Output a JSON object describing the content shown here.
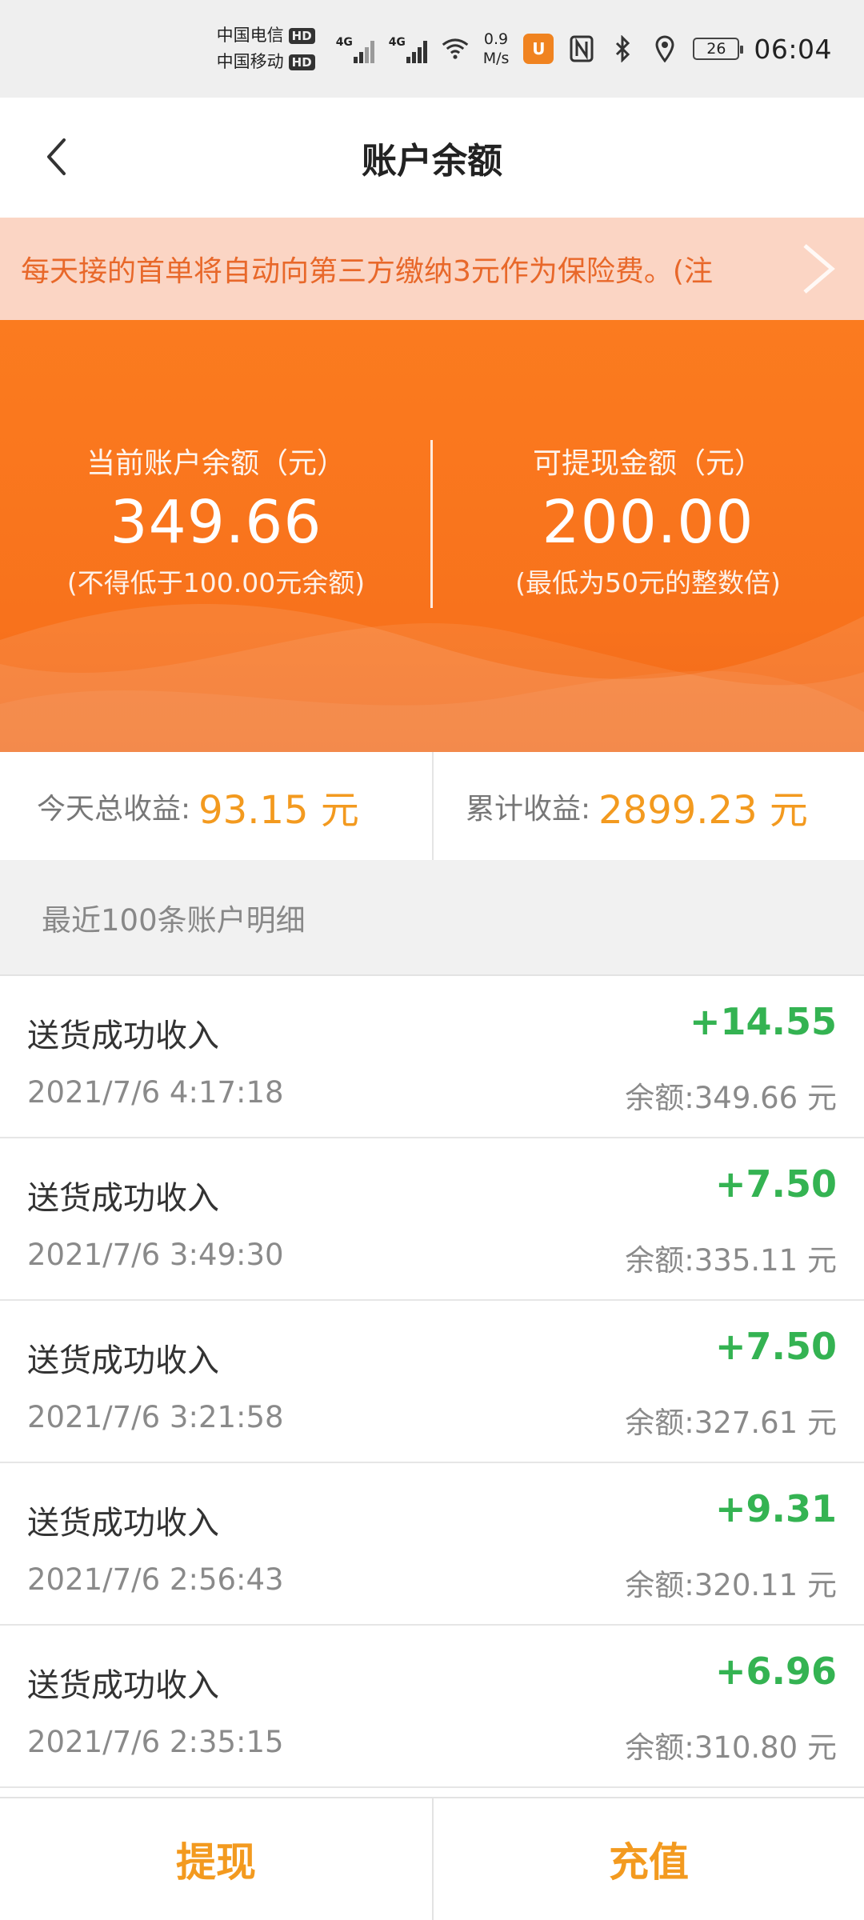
{
  "status_bar": {
    "carrier_1": "中国电信",
    "carrier_2": "中国移动",
    "hd_label": "HD",
    "net_type_1": "4G",
    "net_type_2": "4G",
    "speed_value": "0.9",
    "speed_unit": "M/s",
    "app_badge": "U",
    "battery": "26",
    "time": "06:04"
  },
  "nav": {
    "title": "账户余额"
  },
  "notice": {
    "text": "每天接的首单将自动向第三方缴纳3元作为保险费。(注"
  },
  "balance": {
    "current_label": "当前账户余额（元）",
    "current_value": "349.66",
    "current_note": "(不得低于100.00元余额)",
    "withdrawable_label": "可提现金额（元）",
    "withdrawable_value": "200.00",
    "withdrawable_note": "(最低为50元的整数倍)"
  },
  "earnings": {
    "today_label": "今天总收益:",
    "today_value": "93.15 元",
    "total_label": "累计收益:",
    "total_value": "2899.23 元"
  },
  "section": {
    "title": "最近100条账户明细"
  },
  "transactions": [
    {
      "title": "送货成功收入",
      "time": "2021/7/6 4:17:18",
      "amount": "+14.55",
      "balance": "余额:349.66 元"
    },
    {
      "title": "送货成功收入",
      "time": "2021/7/6 3:49:30",
      "amount": "+7.50",
      "balance": "余额:335.11 元"
    },
    {
      "title": "送货成功收入",
      "time": "2021/7/6 3:21:58",
      "amount": "+7.50",
      "balance": "余额:327.61 元"
    },
    {
      "title": "送货成功收入",
      "time": "2021/7/6 2:56:43",
      "amount": "+9.31",
      "balance": "余额:320.11 元"
    },
    {
      "title": "送货成功收入",
      "time": "2021/7/6 2:35:15",
      "amount": "+6.96",
      "balance": "余额:310.80 元"
    }
  ],
  "bottom": {
    "withdraw_label": "提现",
    "recharge_label": "充值"
  },
  "colors": {
    "accent_orange": "#f8721c",
    "amount_green": "#34b352",
    "earnings_orange": "#f39a1f",
    "notice_bg": "#fbd5c4"
  }
}
